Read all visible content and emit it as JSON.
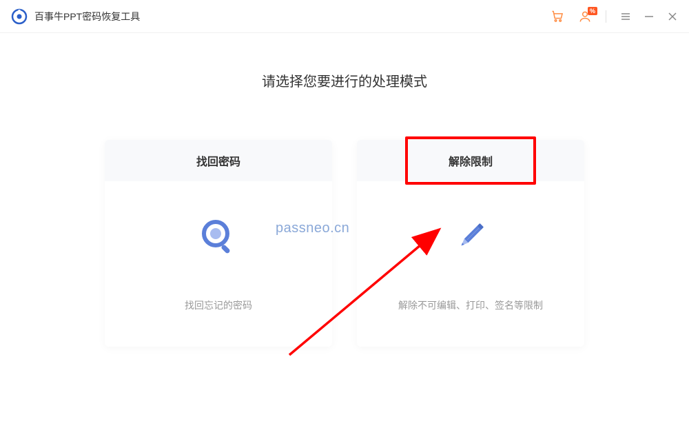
{
  "titlebar": {
    "app_title": "百事牛PPT密码恢复工具"
  },
  "main": {
    "heading": "请选择您要进行的处理模式",
    "cards": [
      {
        "title": "找回密码",
        "description": "找回忘记的密码"
      },
      {
        "title": "解除限制",
        "description": "解除不可编辑、打印、签名等限制"
      }
    ]
  },
  "watermark": "passneo.cn",
  "colors": {
    "accent": "#5b7fd9",
    "cart": "#ff8c42",
    "highlight": "#ff0000"
  }
}
